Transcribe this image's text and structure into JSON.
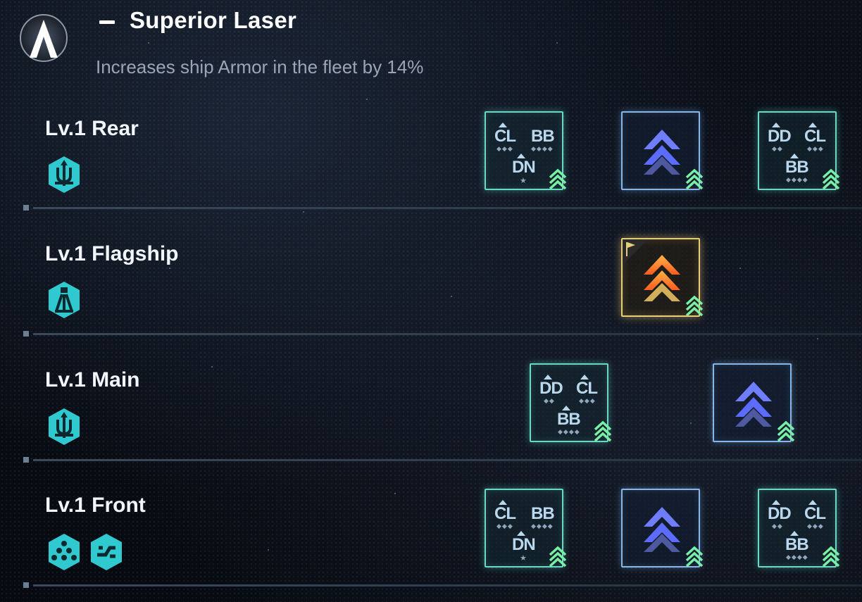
{
  "header": {
    "title": "Superior Laser",
    "description": "Increases ship Armor in the fleet by 14%",
    "logo_icon": "delta-emblem-icon"
  },
  "rows": [
    {
      "label": "Lv.1 Rear",
      "badges": [
        "trident-hex-icon"
      ],
      "slots": [
        {
          "type": "ship-classes",
          "codes": [
            "CL",
            "BB",
            "DN"
          ],
          "upgrade": true
        },
        {
          "type": "rank-chevron",
          "color": "#6f7dff",
          "upgrade": true
        },
        {
          "type": "ship-classes",
          "codes": [
            "DD",
            "CL",
            "BB"
          ],
          "upgrade": true
        }
      ]
    },
    {
      "label": "Lv.1 Flagship",
      "badges": [
        "tower-hex-icon"
      ],
      "slots": [
        {
          "type": "flagship-chevron",
          "color": "#ff8a2a",
          "upgrade": true
        }
      ]
    },
    {
      "label": "Lv.1 Main",
      "badges": [
        "trident-hex-icon"
      ],
      "slots": [
        {
          "type": "ship-classes",
          "codes": [
            "DD",
            "CL",
            "BB"
          ],
          "upgrade": true
        },
        {
          "type": "rank-chevron",
          "color": "#6f7dff",
          "upgrade": true
        }
      ]
    },
    {
      "label": "Lv.1 Front",
      "badges": [
        "cluster-hex-icon",
        "split-hex-icon"
      ],
      "slots": [
        {
          "type": "ship-classes",
          "codes": [
            "CL",
            "BB",
            "DN"
          ],
          "upgrade": true
        },
        {
          "type": "rank-chevron",
          "color": "#6f7dff",
          "upgrade": true
        },
        {
          "type": "ship-classes",
          "codes": [
            "DD",
            "CL",
            "BB"
          ],
          "upgrade": true
        }
      ]
    }
  ],
  "colors": {
    "teal": "#6fd6c4",
    "blue": "#87b7e6",
    "gold": "#e6cd7a",
    "badge": "#2fc9cf",
    "upgrade": "#7af0a6"
  }
}
